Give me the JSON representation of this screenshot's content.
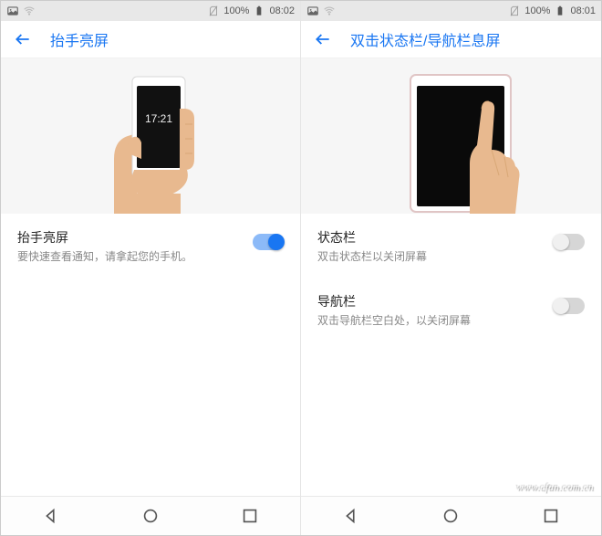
{
  "left": {
    "statusbar": {
      "battery": "100%",
      "time": "08:02"
    },
    "title": "抬手亮屏",
    "illust_time": "17:21",
    "settings": [
      {
        "title": "抬手亮屏",
        "desc": "要快速查看通知，请拿起您的手机。",
        "on": true
      }
    ]
  },
  "right": {
    "statusbar": {
      "battery": "100%",
      "time": "08:01"
    },
    "title": "双击状态栏/导航栏息屏",
    "settings": [
      {
        "title": "状态栏",
        "desc": "双击状态栏以关闭屏幕",
        "on": false
      },
      {
        "title": "导航栏",
        "desc": "双击导航栏空白处，以关闭屏幕",
        "on": false
      }
    ]
  },
  "watermark": "www.cfan.com.cn"
}
